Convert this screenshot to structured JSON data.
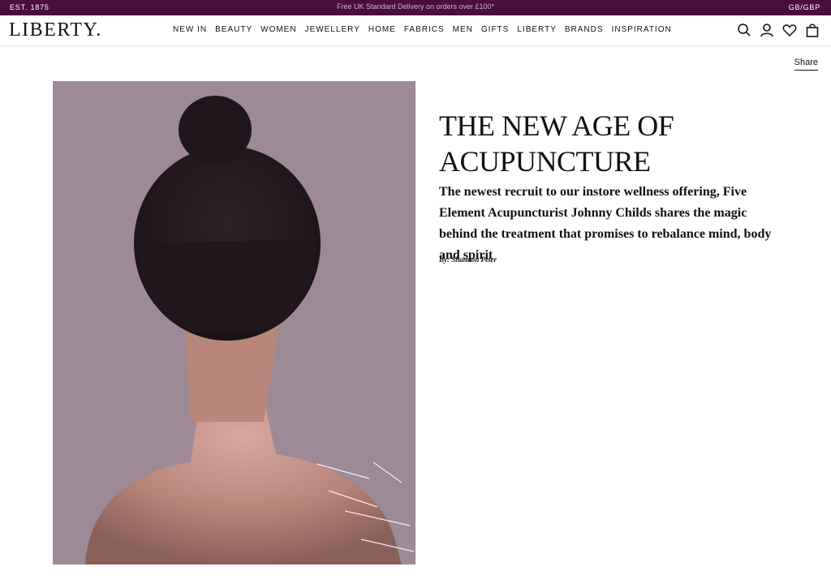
{
  "topbar": {
    "est": "EST. 1875",
    "promo": "Free UK Standard Delivery on orders over £100*",
    "locale": "GB/GBP"
  },
  "header": {
    "logo": "LIBERTY.",
    "nav": [
      "NEW IN",
      "BEAUTY",
      "WOMEN",
      "JEWELLERY",
      "HOME",
      "FABRICS",
      "MEN",
      "GIFTS",
      "LIBERTY",
      "BRANDS",
      "INSPIRATION"
    ],
    "icons": [
      "search-icon",
      "account-icon",
      "wishlist-icon",
      "bag-icon"
    ]
  },
  "article": {
    "share_label": "Share",
    "title": "THE NEW AGE OF ACUPUNCTURE",
    "subtitle": "The newest recruit to our instore wellness offering, Five Element Acupuncturist Johnny Childs shares the magic behind the treatment that promises to rebalance mind, body and spirit",
    "byline": "By: Shannon Peter"
  },
  "colors": {
    "topbar_bg": "#4a0d3c",
    "text": "#111111"
  }
}
